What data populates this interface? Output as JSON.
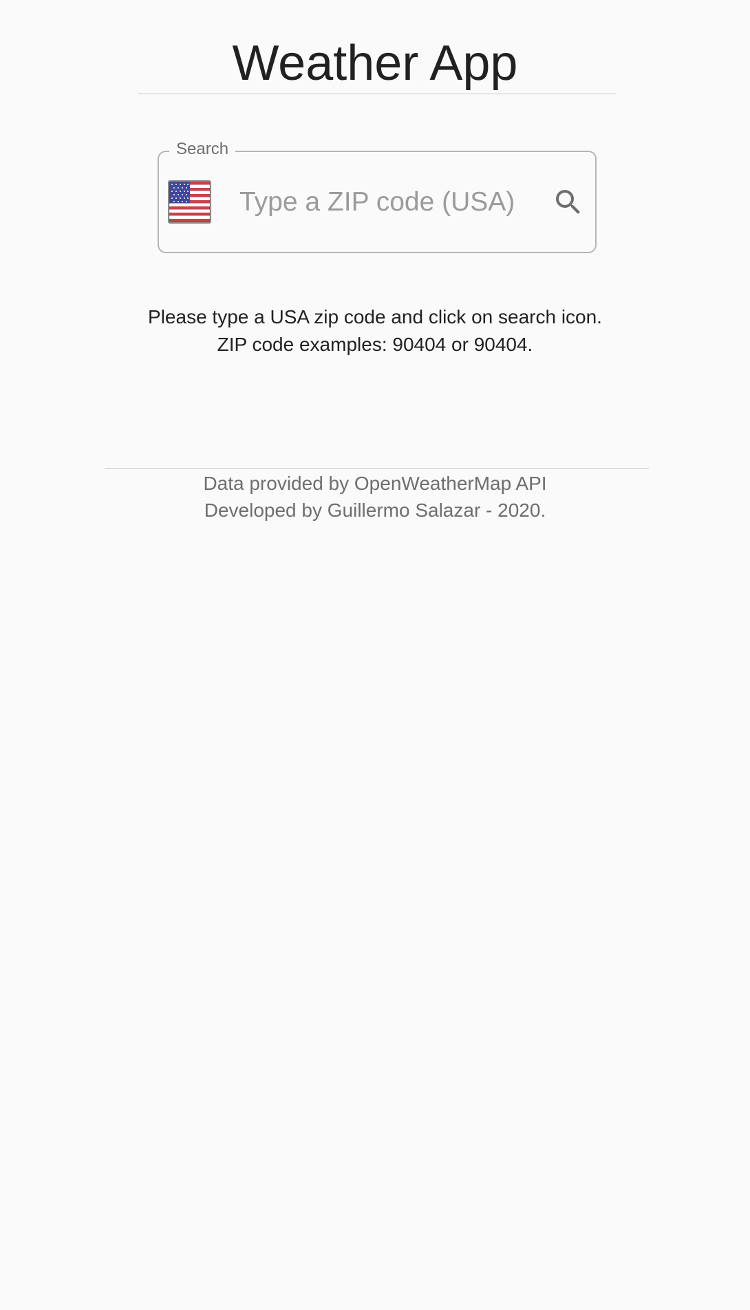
{
  "app": {
    "title": "Weather App"
  },
  "search": {
    "label": "Search",
    "placeholder": "Type a ZIP code (USA)",
    "value": "",
    "country_flag": "usa-flag-icon",
    "button_icon": "search-icon"
  },
  "instructions": {
    "line1": "Please type a USA zip code and click on search icon.",
    "line2": "ZIP code examples: 90404 or 90404."
  },
  "footer": {
    "line1": "Data provided by OpenWeatherMap API",
    "line2": "Developed by Guillermo Salazar - 2020."
  },
  "colors": {
    "background": "#fafafa",
    "text_primary": "#212121",
    "text_secondary": "#6e6e6e",
    "border": "#b5b5b5"
  }
}
